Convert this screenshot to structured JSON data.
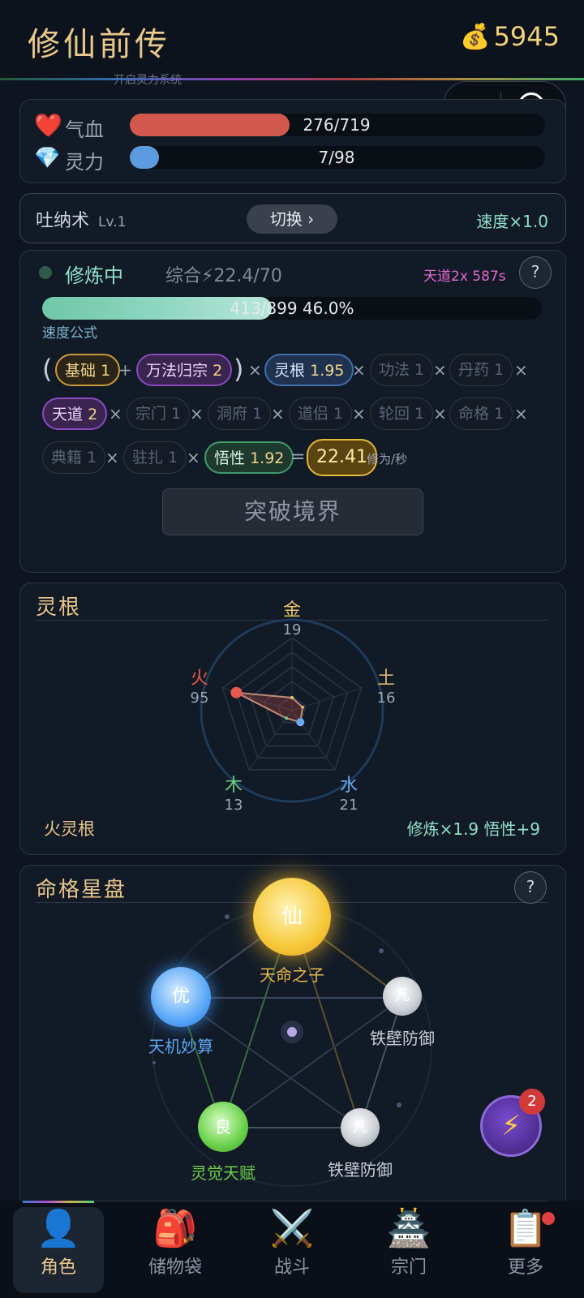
{
  "app": {
    "title": "修仙前传",
    "coin_icon": "money-bag-icon",
    "coins": "5945",
    "hidden_strip": "开启灵力系统"
  },
  "capsule": {
    "menu": "•••"
  },
  "stats": {
    "hp": {
      "icon": "heart-icon",
      "label": "气血",
      "value": "276/719",
      "fraction": 0.384,
      "color": "#d0584c"
    },
    "mp": {
      "icon": "diamond-icon",
      "label": "灵力",
      "value": "7/98",
      "fraction": 0.071,
      "color": "#5b9be0"
    }
  },
  "technique": {
    "name": "吐纳术",
    "level": "Lv.1",
    "switch_label": "切换 ›",
    "speed": "速度×1.0"
  },
  "cultivation": {
    "status": "修炼中",
    "overall": "综合⚡22.4/70",
    "tiandao": "天道2x 587s",
    "help": "?",
    "progress_text": "413/899  46.0%",
    "progress": 0.46,
    "formula_label": "速度公式",
    "chips": {
      "base": {
        "name": "基础",
        "val": "1"
      },
      "sect_all": {
        "name": "万法归宗",
        "val": "2"
      },
      "root": {
        "name": "灵根",
        "val": "1.95"
      },
      "gongfa": "功法 1",
      "pill": "丹药 1",
      "tiandao": {
        "name": "天道",
        "val": "2"
      },
      "sect": "宗门 1",
      "cave": "洞府 1",
      "partner": "道侣 1",
      "reincarnation": "轮回 1",
      "fate": "命格 1",
      "books": "典籍 1",
      "station": "驻扎 1",
      "insight": {
        "name": "悟性",
        "val": "1.92"
      },
      "result": "22.41"
    },
    "ops": {
      "plus": "+",
      "times": "×",
      "equals": "=",
      "open": "(",
      "close": ")"
    },
    "unit": "修为/秒",
    "break_label": "突破境界"
  },
  "spirit_root": {
    "title": "灵根",
    "elements": [
      {
        "name": "金",
        "value": "19",
        "color": "#e8c56a"
      },
      {
        "name": "土",
        "value": "16",
        "color": "#d9b56a"
      },
      {
        "name": "水",
        "value": "21",
        "color": "#6aa8f0"
      },
      {
        "name": "木",
        "value": "13",
        "color": "#6ad08a"
      },
      {
        "name": "火",
        "value": "95",
        "color": "#e8584c"
      }
    ],
    "root_name": "火灵根",
    "bonus": "修炼×1.9  悟性+9"
  },
  "fate_chart": {
    "title": "命格星盘",
    "help": "?",
    "nodes": [
      {
        "glyph": "仙",
        "name": "天命之子",
        "rank": "legend"
      },
      {
        "glyph": "凡",
        "name": "铁壁防御",
        "rank": "common"
      },
      {
        "glyph": "凡",
        "name": "铁壁防御",
        "rank": "common"
      },
      {
        "glyph": "良",
        "name": "灵觉天赋",
        "rank": "good"
      },
      {
        "glyph": "优",
        "name": "天机妙算",
        "rank": "excellent"
      }
    ],
    "fab_badge": "2",
    "fab_icon": "lightning-icon"
  },
  "nav": [
    {
      "icon": "person-icon",
      "glyph": "👤",
      "label": "角色",
      "active": true
    },
    {
      "icon": "backpack-icon",
      "glyph": "🎒",
      "label": "储物袋"
    },
    {
      "icon": "swords-icon",
      "glyph": "⚔️",
      "label": "战斗"
    },
    {
      "icon": "temple-icon",
      "glyph": "🏯",
      "label": "宗门"
    },
    {
      "icon": "clipboard-icon",
      "glyph": "📋",
      "label": "更多",
      "dot": true
    }
  ]
}
